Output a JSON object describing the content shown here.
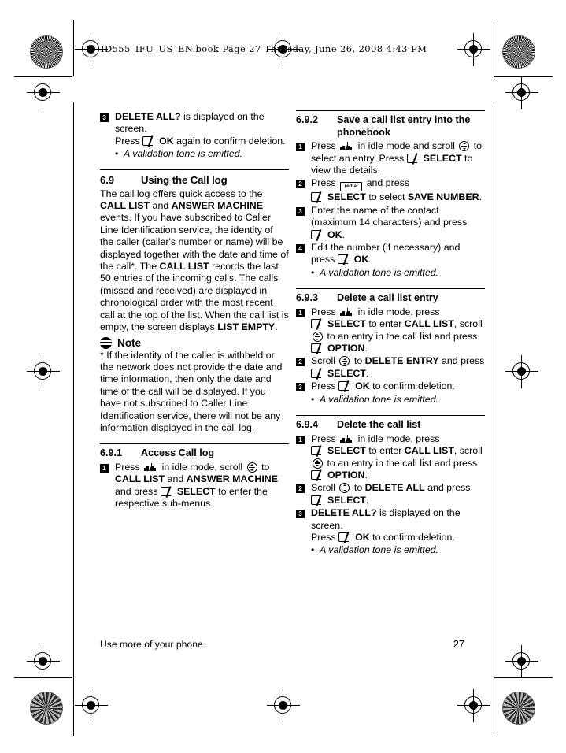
{
  "running_head": {
    "text": "ID555_IFU_US_EN.book   Page 27   Thursday, June 26, 2008   4:43 PM"
  },
  "icons": {
    "softkey": "softkey-icon",
    "callid": "callid-icon",
    "scroll": "scroll-icon",
    "redial_label": "redial",
    "note": "note-icon"
  },
  "left_column": {
    "step3": {
      "number": "3",
      "line1_bold": "DELETE ALL?",
      "line1_rest": " is displayed on the screen.",
      "line2_pre": "Press ",
      "line2_bold": "OK",
      "line2_rest": " again to confirm deletion.",
      "bullet": "A validation tone is emitted."
    },
    "section_6_9": {
      "number": "6.9",
      "title": "Using the Call log",
      "para_a": "The call log offers quick access to the ",
      "para_b1": "CALL LIST",
      "para_b2": " and ",
      "para_b3": "ANSWER MACHINE",
      "para_c": " events. If you have subscribed to Caller Line Identification service, the identity of the caller (caller's number or name) will be displayed together with the date and time of the call*. The ",
      "para_d": "CALL LIST",
      "para_e": " records the last 50 entries of the incoming calls. The calls (missed and received) are displayed in chronological order with the most recent call at the top of the list. When the call list is empty, the screen displays ",
      "para_f": "LIST EMPTY",
      "para_g": "."
    },
    "note": {
      "label": "Note",
      "body": "* If the identity of the caller is withheld or the network does not provide the date and time information, then only the date and time of the call will be displayed. If you have not subscribed to Caller Line Identification service, there will not be any information displayed in the call log."
    },
    "section_6_9_1": {
      "number": "6.9.1",
      "title": "Access Call log",
      "step1": {
        "number": "1",
        "t1": "Press ",
        "t2": " in idle mode, scroll ",
        "t3": " to ",
        "b1": "CALL LIST",
        "t4": " and ",
        "b2": "ANSWER MACHINE",
        "t5": " and press ",
        "b3": "SELECT",
        "t6": " to enter the respective sub-menus."
      }
    }
  },
  "right_column": {
    "section_6_9_2": {
      "number": "6.9.2",
      "title": "Save a call list entry into the phonebook",
      "step1": {
        "number": "1",
        "t1": "Press ",
        "t2": " in idle mode and scroll ",
        "t3": " to select an entry. Press ",
        "b1": "SELECT",
        "t4": " to view the details."
      },
      "step2": {
        "number": "2",
        "t1": "Press ",
        "t2": " and press ",
        "b1": "SELECT",
        "t3": " to select ",
        "b2": "SAVE NUMBER",
        "t4": "."
      },
      "step3": {
        "number": "3",
        "t1": "Enter the name of the contact (maximum 14 characters) and press ",
        "b1": "OK",
        "t2": "."
      },
      "step4": {
        "number": "4",
        "t1": "Edit the number (if necessary) and press ",
        "b1": "OK",
        "t2": ".",
        "bullet": "A validation tone is emitted."
      }
    },
    "section_6_9_3": {
      "number": "6.9.3",
      "title": "Delete a call list entry",
      "step1": {
        "number": "1",
        "t1": "Press ",
        "t2": " in idle mode, press ",
        "b1": "SELECT",
        "t3": " to enter ",
        "b2": "CALL LIST",
        "t4": ", scroll ",
        "t5": " to an entry in the call list and press ",
        "b3": "OPTION",
        "t6": "."
      },
      "step2": {
        "number": "2",
        "t1": "Scroll ",
        "t2": " to ",
        "b1": "DELETE ENTRY",
        "t3": " and press ",
        "b2": "SELECT",
        "t4": "."
      },
      "step3": {
        "number": "3",
        "t1": "Press ",
        "b1": "OK",
        "t2": " to confirm deletion.",
        "bullet": "A validation tone is emitted."
      }
    },
    "section_6_9_4": {
      "number": "6.9.4",
      "title": "Delete the call list",
      "step1": {
        "number": "1",
        "t1": "Press ",
        "t2": " in idle mode, press ",
        "b1": "SELECT",
        "t3": " to enter ",
        "b2": "CALL LIST",
        "t4": ", scroll ",
        "t5": " to an entry in the call list and press ",
        "b3": "OPTION",
        "t6": "."
      },
      "step2": {
        "number": "2",
        "t1": "Scroll ",
        "t2": " to ",
        "b1": "DELETE ALL",
        "t3": " and press ",
        "b2": "SELECT",
        "t4": "."
      },
      "step3": {
        "number": "3",
        "b1": "DELETE ALL?",
        "t1": " is displayed on the screen.",
        "t2": "Press ",
        "b2": "OK",
        "t3": " to confirm deletion.",
        "bullet": "A validation tone is emitted."
      }
    }
  },
  "footer": {
    "chapter": "Use more of your phone",
    "page_number": "27"
  }
}
